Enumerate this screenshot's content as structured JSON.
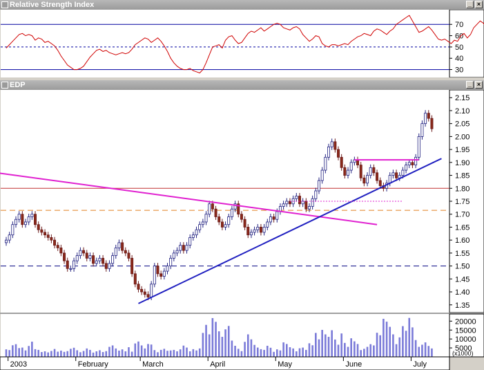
{
  "rsi_window": {
    "title": "Relative Strength Index",
    "buttons": {
      "minimize": "_",
      "close": "×"
    }
  },
  "price_window": {
    "title": "EDP",
    "buttons": {
      "minimize": "_",
      "close": "×"
    }
  },
  "chart_data": [
    {
      "type": "line",
      "title": "Relative Strength Index",
      "ylim": [
        23,
        83
      ],
      "yticks": [
        30,
        40,
        50,
        60,
        70
      ],
      "ytick_labels": [
        "30",
        "40",
        "50",
        "60",
        "70"
      ],
      "reference_lines": [
        {
          "value": 70,
          "style": "solid",
          "color": "#0000a0"
        },
        {
          "value": 50,
          "style": "dashed",
          "color": "#0000a0"
        },
        {
          "value": 30,
          "style": "solid",
          "color": "#0000a0"
        }
      ],
      "series": [
        {
          "color": "#d00000",
          "values": [
            49,
            52,
            55,
            58,
            61,
            62,
            60,
            61,
            60,
            56,
            58,
            57,
            54,
            55,
            53,
            51,
            47,
            42,
            38,
            34,
            32,
            30,
            30,
            31,
            33,
            37,
            41,
            44,
            47,
            48,
            46,
            47,
            45,
            44,
            43,
            44,
            45,
            44,
            45,
            48,
            52,
            54,
            56,
            58,
            57,
            54,
            56,
            58,
            55,
            51,
            46,
            40,
            36,
            33,
            31,
            30,
            30,
            31,
            29,
            28,
            27,
            30,
            36,
            43,
            50,
            51,
            52,
            49,
            56,
            59,
            60,
            56,
            53,
            54,
            58,
            62,
            64,
            63,
            65,
            67,
            64,
            66,
            68,
            70,
            71,
            70,
            67,
            66,
            65,
            67,
            68,
            66,
            61,
            58,
            55,
            57,
            60,
            59,
            53,
            51,
            50,
            52,
            52,
            51,
            52,
            53,
            52,
            55,
            57,
            59,
            60,
            62,
            61,
            60,
            64,
            66,
            65,
            63,
            61,
            64,
            66,
            70,
            72,
            74,
            76,
            78,
            73,
            68,
            63,
            64,
            66,
            68,
            65,
            61,
            57,
            56,
            57,
            55,
            53,
            56,
            55,
            60,
            62,
            58,
            61,
            67,
            70,
            73,
            71,
            66,
            63,
            65
          ]
        }
      ]
    },
    {
      "type": "candlestick",
      "title": "EDP",
      "ylim": [
        1.32,
        2.18
      ],
      "yticks": [
        1.35,
        1.4,
        1.45,
        1.5,
        1.55,
        1.6,
        1.65,
        1.7,
        1.75,
        1.8,
        1.85,
        1.9,
        1.95,
        2.0,
        2.05,
        2.1,
        2.15
      ],
      "ytick_labels": [
        "1.35",
        "1.40",
        "1.45",
        "1.50",
        "1.55",
        "1.60",
        "1.65",
        "1.70",
        "1.75",
        "1.80",
        "1.85",
        "1.90",
        "1.95",
        "2.00",
        "2.05",
        "2.10",
        "2.15"
      ],
      "x_labels": [
        {
          "label": "2003",
          "index": 1
        },
        {
          "label": "February",
          "index": 22
        },
        {
          "label": "March",
          "index": 42
        },
        {
          "label": "April",
          "index": 63
        },
        {
          "label": "May",
          "index": 84
        },
        {
          "label": "June",
          "index": 105
        },
        {
          "label": "July",
          "index": 126
        }
      ],
      "horizontal_lines": [
        {
          "value": 1.8,
          "style": "solid",
          "color": "#c03030"
        },
        {
          "value": 1.715,
          "style": "dashed",
          "color": "#e08020"
        },
        {
          "value": 1.5,
          "style": "dashed",
          "color": "#000080"
        }
      ],
      "trendlines": [
        {
          "from": [
            -3,
            1.86
          ],
          "to": [
            115,
            1.66
          ],
          "color": "#e020d0"
        },
        {
          "from": [
            41,
            1.355
          ],
          "to": [
            135,
            1.915
          ],
          "color": "#2020c0"
        },
        {
          "from": [
            88,
            1.75
          ],
          "to": [
            123,
            1.75
          ],
          "color": "#e020d0",
          "style": "dotted"
        },
        {
          "from": [
            108,
            1.91
          ],
          "to": [
            128,
            1.91
          ],
          "color": "#e020d0"
        }
      ],
      "close": [
        1.6,
        1.62,
        1.66,
        1.68,
        1.7,
        1.66,
        1.67,
        1.69,
        1.7,
        1.66,
        1.64,
        1.63,
        1.62,
        1.61,
        1.6,
        1.58,
        1.57,
        1.55,
        1.52,
        1.49,
        1.49,
        1.52,
        1.54,
        1.56,
        1.55,
        1.53,
        1.54,
        1.51,
        1.52,
        1.53,
        1.51,
        1.49,
        1.51,
        1.54,
        1.57,
        1.59,
        1.56,
        1.55,
        1.53,
        1.47,
        1.43,
        1.41,
        1.4,
        1.39,
        1.38,
        1.43,
        1.5,
        1.47,
        1.46,
        1.48,
        1.5,
        1.53,
        1.55,
        1.56,
        1.58,
        1.56,
        1.58,
        1.61,
        1.62,
        1.64,
        1.66,
        1.67,
        1.7,
        1.74,
        1.72,
        1.69,
        1.67,
        1.65,
        1.66,
        1.69,
        1.72,
        1.74,
        1.7,
        1.68,
        1.65,
        1.62,
        1.63,
        1.64,
        1.65,
        1.63,
        1.65,
        1.67,
        1.69,
        1.68,
        1.71,
        1.73,
        1.74,
        1.75,
        1.74,
        1.76,
        1.77,
        1.74,
        1.75,
        1.72,
        1.73,
        1.76,
        1.79,
        1.83,
        1.87,
        1.92,
        1.96,
        1.98,
        1.95,
        1.92,
        1.88,
        1.85,
        1.87,
        1.9,
        1.91,
        1.89,
        1.84,
        1.82,
        1.85,
        1.88,
        1.86,
        1.83,
        1.81,
        1.8,
        1.82,
        1.85,
        1.86,
        1.84,
        1.85,
        1.87,
        1.89,
        1.9,
        1.89,
        1.92,
        2.0,
        2.05,
        2.09,
        2.07,
        2.03
      ],
      "volume_panel": {
        "ylim": [
          0,
          24000
        ],
        "yticks": [
          5000,
          10000,
          15000,
          20000
        ],
        "ytick_labels": [
          "5000",
          "10000",
          "15000",
          "20000"
        ],
        "unit_label": "(x1000)",
        "values": [
          4200,
          3800,
          6500,
          7100,
          4900,
          5200,
          3600,
          6100,
          8500,
          4300,
          3900,
          2700,
          3100,
          2500,
          3300,
          4400,
          2900,
          3500,
          2800,
          3200,
          4500,
          5100,
          3700,
          2600,
          3300,
          4700,
          3900,
          2400,
          3100,
          3700,
          2700,
          3200,
          5600,
          6400,
          4700,
          3500,
          4200,
          3100,
          5400,
          2900,
          7500,
          8600,
          6400,
          4700,
          7200,
          6900,
          3800,
          2600,
          3900,
          4500,
          3400,
          3600,
          3900,
          3100,
          4200,
          6300,
          5200,
          3100,
          4300,
          3600,
          4700,
          13400,
          17900,
          12600,
          21700,
          19600,
          14300,
          11200,
          15400,
          17300,
          9100,
          6200,
          4500,
          3200,
          8400,
          12600,
          9800,
          6700,
          5200,
          4300,
          3900,
          6200,
          5100,
          2800,
          4200,
          3600,
          8100,
          7200,
          5400,
          4700,
          3100,
          4800,
          5200,
          3900,
          7600,
          6500,
          13400,
          9800,
          15100,
          12600,
          11200,
          14900,
          9700,
          6800,
          13100,
          7800,
          5600,
          10400,
          8700,
          7200,
          3800,
          4500,
          5600,
          7100,
          6400,
          13500,
          12100,
          21300,
          19700,
          16800,
          12600,
          7100,
          10900,
          17200,
          14600,
          21800,
          16500,
          9400,
          5600,
          6800,
          8100,
          6100,
          4700
        ]
      }
    }
  ]
}
